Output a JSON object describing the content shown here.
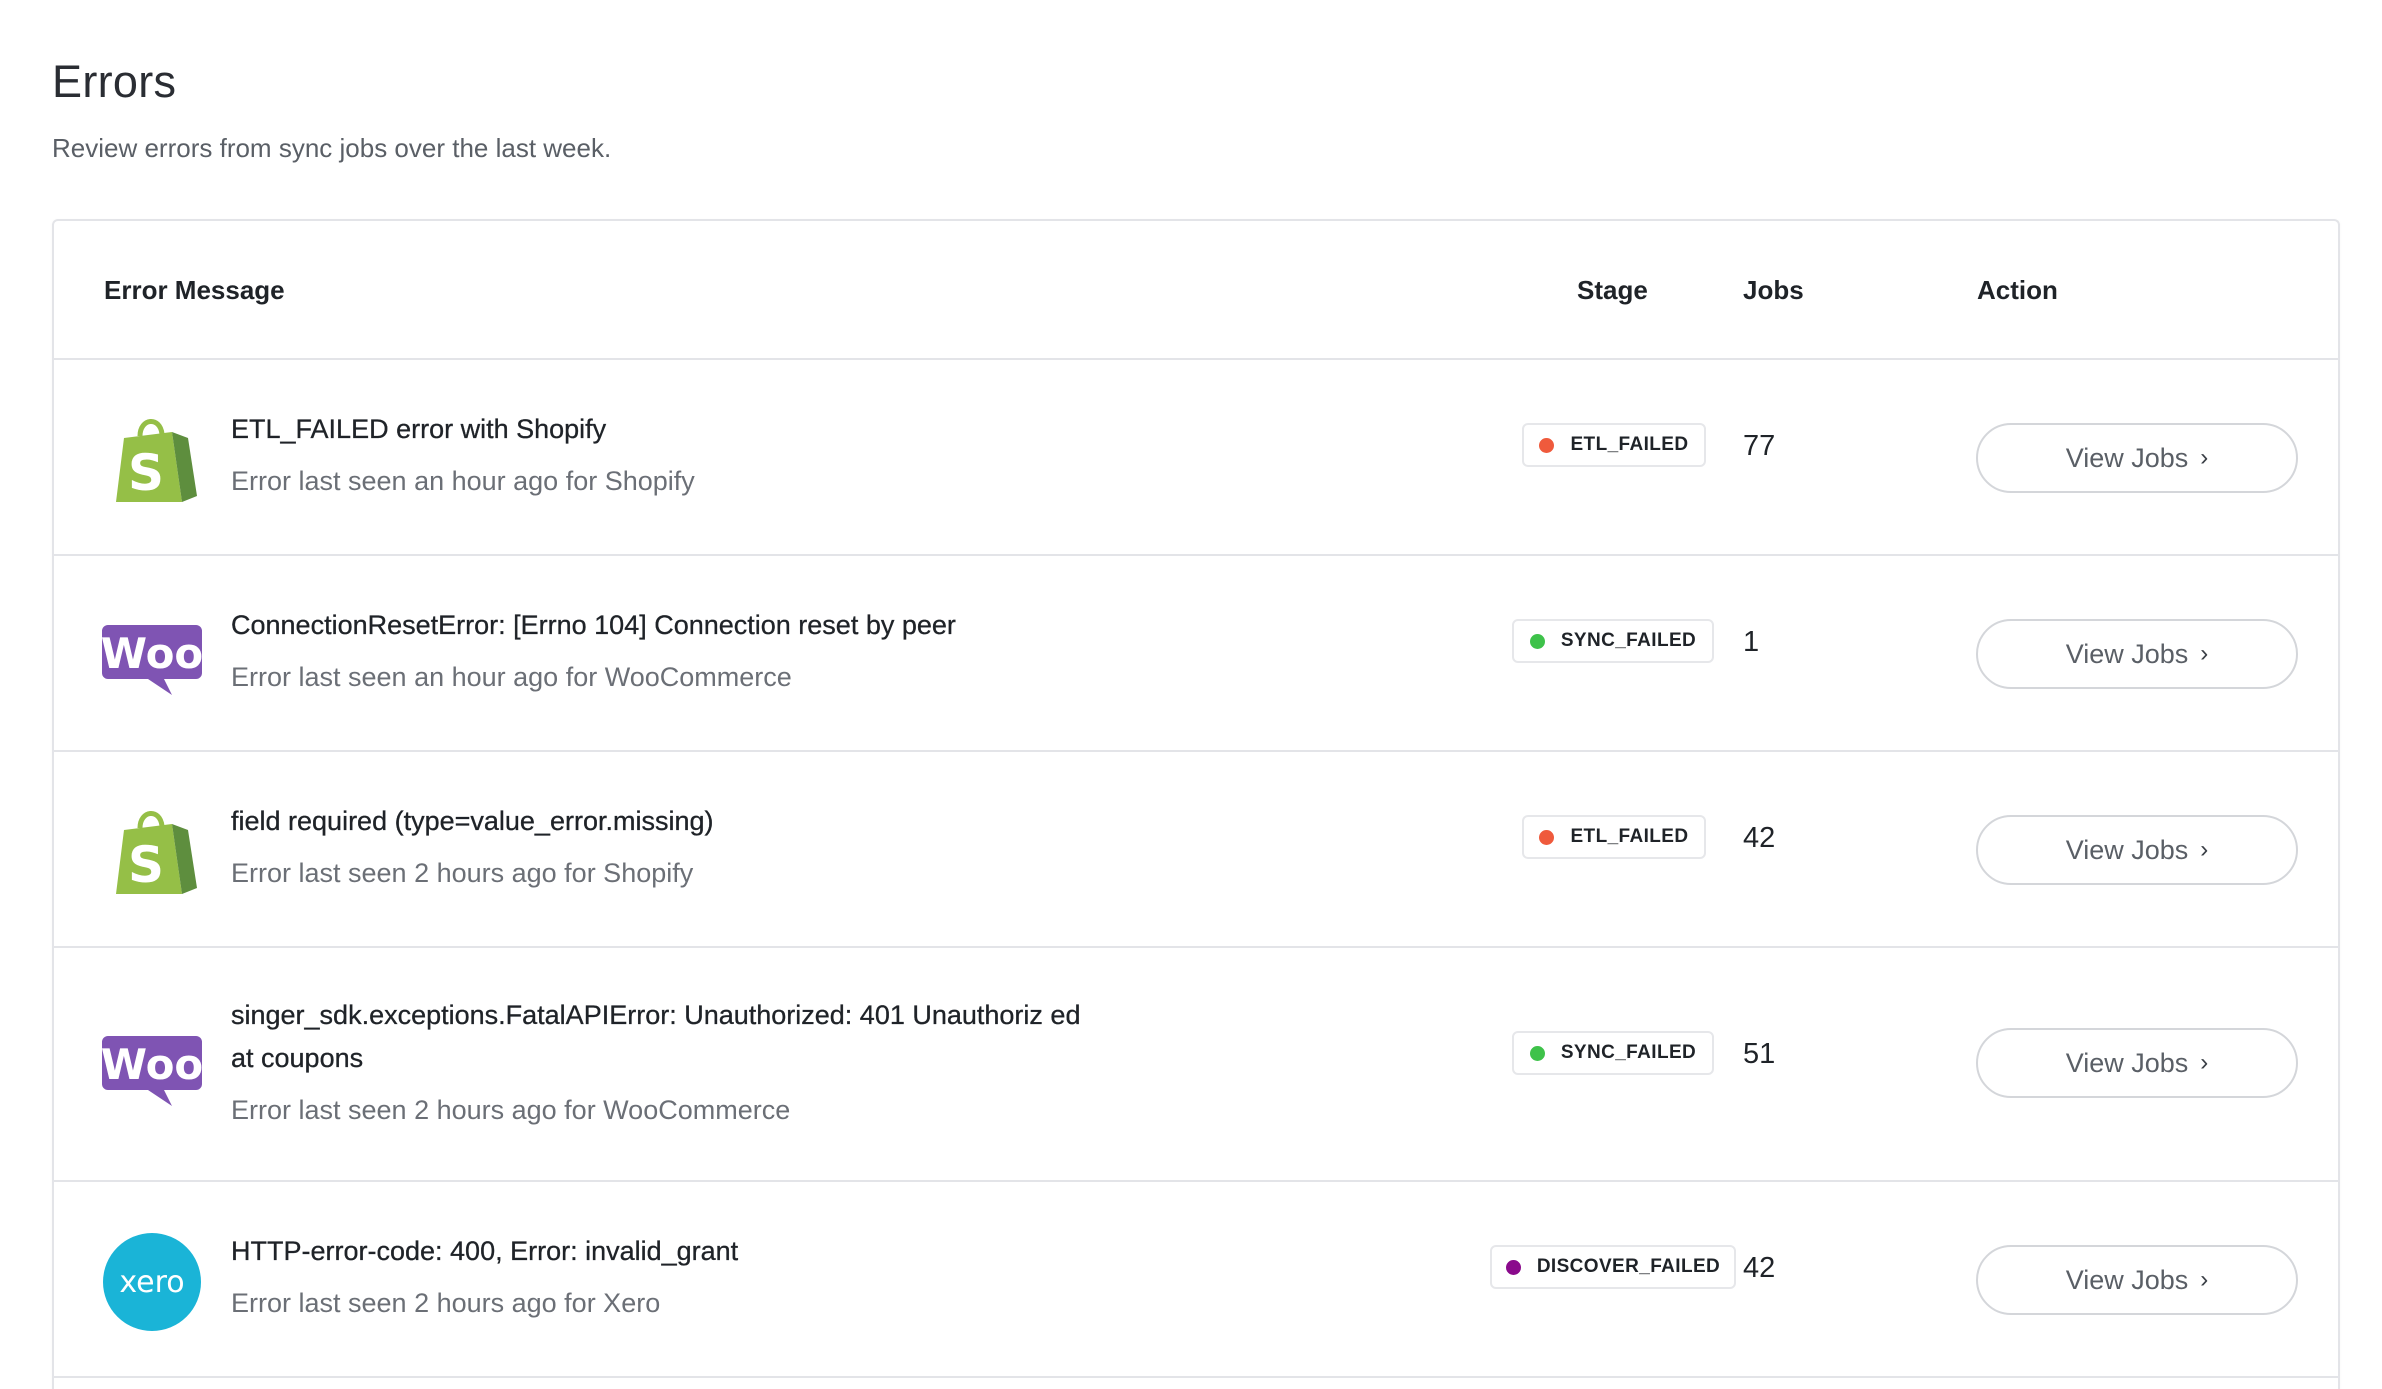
{
  "header": {
    "title": "Errors",
    "subtitle": "Review errors from sync jobs over the last week."
  },
  "table": {
    "columns": {
      "error_message": "Error Message",
      "stage": "Stage",
      "jobs": "Jobs",
      "action": "Action"
    },
    "rows": [
      {
        "logo": "shopify-icon",
        "message": "ETL_FAILED error with Shopify",
        "detail": "Error last seen an hour ago for Shopify",
        "stage": "ETL_FAILED",
        "stage_color": "#ef5a3c",
        "jobs": "77",
        "action_label": "View Jobs"
      },
      {
        "logo": "woocommerce-icon",
        "message": "ConnectionResetError: [Errno 104] Connection reset by peer",
        "detail": "Error last seen an hour ago for WooCommerce",
        "stage": "SYNC_FAILED",
        "stage_color": "#3ec24a",
        "jobs": "1",
        "action_label": "View Jobs"
      },
      {
        "logo": "shopify-icon",
        "message": "field required (type=value_error.missing)",
        "detail": "Error last seen 2 hours ago for Shopify",
        "stage": "ETL_FAILED",
        "stage_color": "#ef5a3c",
        "jobs": "42",
        "action_label": "View Jobs"
      },
      {
        "logo": "woocommerce-icon",
        "message": "singer_sdk.exceptions.FatalAPIError: Unauthorized: 401 Unauthoriz ed at coupons",
        "detail": "Error last seen 2 hours ago for WooCommerce",
        "stage": "SYNC_FAILED",
        "stage_color": "#3ec24a",
        "jobs": "51",
        "action_label": "View Jobs"
      },
      {
        "logo": "xero-icon",
        "message": "HTTP-error-code: 400, Error: invalid_grant",
        "detail": "Error last seen 2 hours ago for Xero",
        "stage": "DISCOVER_FAILED",
        "stage_color": "#8a0a8c",
        "jobs": "42",
        "action_label": "View Jobs"
      }
    ]
  },
  "logos": {
    "woo_text": "Woo",
    "xero_text": "xero"
  },
  "colors": {
    "shopify_green": "#95bf47",
    "shopify_dark": "#5e8e3e",
    "woo_purple": "#7f54b3",
    "xero_blue": "#1ab4d7"
  }
}
